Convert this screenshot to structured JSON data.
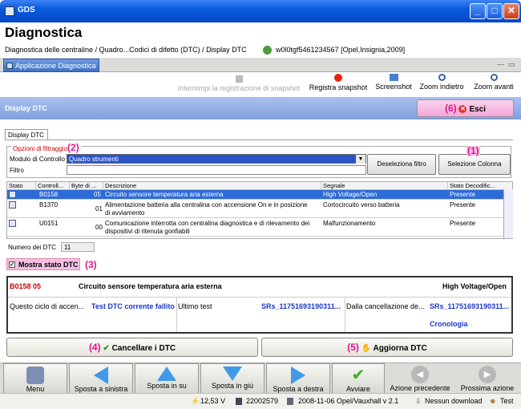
{
  "window": {
    "title": "GDS"
  },
  "header": {
    "title": "Diagnostica",
    "breadcrumb": "Diagnostica delle centraline / Quadro...Codici di difetto (DTC) / Display DTC",
    "vehicle": "w0l0tgf5461234567 [Opel,Insignia,2009]"
  },
  "app_tab": {
    "label": "Applicazione Diagnostica"
  },
  "toolbar": {
    "stop_snapshot": "Interrompi la registrazione di snapshot",
    "record_snapshot": "Registra snapshot",
    "screenshot": "Screenshot",
    "zoom_out": "Zoom indietro",
    "zoom_in": "Zoom avanti"
  },
  "section": {
    "title": "Display DTC",
    "exit_callout": "(6)",
    "exit_label": "Esci"
  },
  "subtab": {
    "label": "Display DTC"
  },
  "filter": {
    "legend": "Opzioni di filtraggio",
    "legend_callout": "(2)",
    "module_label": "Modulo di Controllo",
    "module_value": "Quadro strumenti",
    "filter_label": "Filtro",
    "filter_value": "",
    "deselect_button": "Deseleziona filtro",
    "select_column_button": "Selezione Colonna",
    "select_column_callout": "(1)"
  },
  "table": {
    "headers": [
      "Stato",
      "Controll...",
      "Byte di ...",
      "Descrizione",
      "Segnale",
      "Stato Decodific..."
    ],
    "rows": [
      {
        "code": "B0158",
        "byte": "05",
        "desc1": "Circuito sensore temperatura aria esterna",
        "desc2": "",
        "signal": "High Voltage/Open",
        "status": "Presente"
      },
      {
        "code": "B1370",
        "byte": "01",
        "desc1": "Alimentazione batteria alla centralina con accensione On e in posizione",
        "desc2": "di avviamento",
        "signal": "Cortocircuito verso batteria",
        "status": "Presente"
      },
      {
        "code": "U0151",
        "byte": "00",
        "desc1": "Comunicazione interrotta con centralina diagnostica e di rilevamento dei",
        "desc2": "dispositivi di ritenuta gonfiabili",
        "signal": "Malfunzionamento",
        "status": "Presente"
      }
    ]
  },
  "dtc_count": {
    "label": "Numero dei DTC",
    "value": "11"
  },
  "show_status": {
    "label": "Mostra stato DTC",
    "callout": "(3)",
    "checked": true
  },
  "detail": {
    "code": "B0158 05",
    "description": "Circuito sensore temperatura aria esterna",
    "signal": "High Voltage/Open",
    "cycle_label": "Questo ciclo di accen...",
    "cycle_value": "Test DTC corrente fallito",
    "last_test_label": "Ultimo test",
    "last_test_value": "SRs_11751693190311...",
    "since_clear_label": "Dalla cancellazione de...",
    "since_clear_value": "SRs_11751693190311...",
    "history_link": "Cronologia"
  },
  "actions": {
    "clear_callout": "(4)",
    "clear_label": "Cancellare i DTC",
    "refresh_callout": "(5)",
    "refresh_label": "Aggiorna DTC"
  },
  "bottom_nav": {
    "menu": "Menu",
    "left": "Sposta a sinistra",
    "up": "Sposta in su",
    "down": "Sposta in giù",
    "right": "Sposta a destra",
    "start": "Avviare",
    "prev": "Azione precedente",
    "next": "Prossima azione"
  },
  "status_bar": {
    "voltage": "12,53 V",
    "id": "22002579",
    "version": "2008-11-06 Opel/Vauxhall v 2.1",
    "download": "Nessun download",
    "user": "Test"
  },
  "colors": {
    "accent_blue": "#2b54c9",
    "pink": "#f4c1e5",
    "callout": "#e0168c",
    "code_red": "#d40000",
    "link_blue": "#1a37c8"
  }
}
